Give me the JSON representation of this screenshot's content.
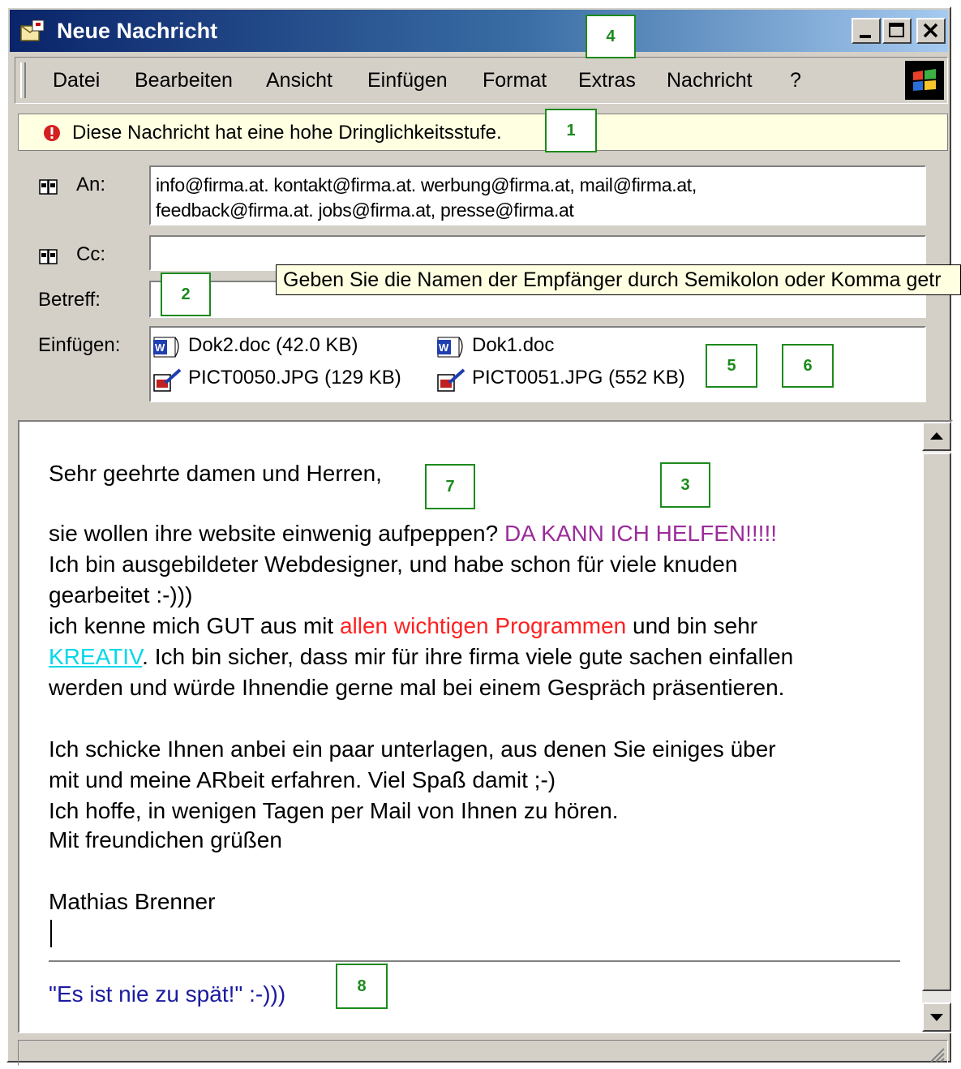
{
  "window": {
    "title": "Neue Nachricht"
  },
  "menu": {
    "items": [
      {
        "label": "Datei"
      },
      {
        "label": "Bearbeiten"
      },
      {
        "label": "Ansicht"
      },
      {
        "label": "Einfügen"
      },
      {
        "label": "Format"
      },
      {
        "label": "Extras"
      },
      {
        "label": "Nachricht"
      },
      {
        "label": "?"
      }
    ]
  },
  "priority_bar": {
    "text": "Diese Nachricht hat eine hohe Dringlichkeitsstufe.",
    "icon": "exclamation-icon"
  },
  "header": {
    "to_label": "An:",
    "to_line1": "info@firma.at. kontakt@firma.at. werbung@firma.at, mail@firma.at,",
    "to_line2": "feedback@firma.at. jobs@firma.at, presse@firma.at",
    "cc_label": "Cc:",
    "cc_value": "",
    "subject_label": "Betreff:",
    "subject_value": "",
    "attach_label": "Einfügen:",
    "tooltip": "Geben Sie die Namen der Empfänger durch Semikolon oder Komma getr"
  },
  "attachments": [
    {
      "name": "Dok2.doc (42.0 KB)",
      "icon": "word-doc-icon"
    },
    {
      "name": "Dok1.doc",
      "icon": "word-doc-icon"
    },
    {
      "name": "PICT0050.JPG (129 KB)",
      "icon": "image-file-icon"
    },
    {
      "name": "PICT0051.JPG (552 KB)",
      "icon": "image-file-icon"
    }
  ],
  "body": {
    "greeting": "Sehr geehrte damen und Herren,",
    "l1a": "sie wollen ihre website einwenig aufpeppen? ",
    "l1b": "DA KANN ICH HELFEN!!!!!",
    "l2": "Ich bin ausgebildeter Webdesigner, und habe schon für viele knuden",
    "l3": "gearbeitet :-)))",
    "l4a": "ich kenne mich GUT aus mit ",
    "l4b": "allen wichtigen Programmen",
    "l4c": " und bin sehr",
    "l5a": "KREATIV",
    "l5b": ". Ich bin sicher, dass mir für ihre firma viele gute sachen einfallen",
    "l6": "werden und würde Ihnendie gerne mal bei einem Gespräch präsentieren.",
    "l7": "Ich schicke Ihnen anbei ein paar unterlagen, aus denen Sie einiges über",
    "l8": "mit und meine ARbeit erfahren. Viel Spaß damit ;-)",
    "l9": "Ich hoffe, in wenigen Tagen per Mail von Ihnen zu hören.",
    "l10": "Mit freundichen grüßen",
    "signature": "Mathias Brenner",
    "motto": "\"Es ist nie zu spät!\" :-)))"
  },
  "colors": {
    "purple": "#9b2d9b",
    "red": "#ff2020",
    "cyan": "#00d8e8",
    "navy": "#1a1aa0",
    "marker": "#1c8a1c"
  },
  "markers": [
    "1",
    "2",
    "3",
    "4",
    "5",
    "6",
    "7",
    "8"
  ]
}
